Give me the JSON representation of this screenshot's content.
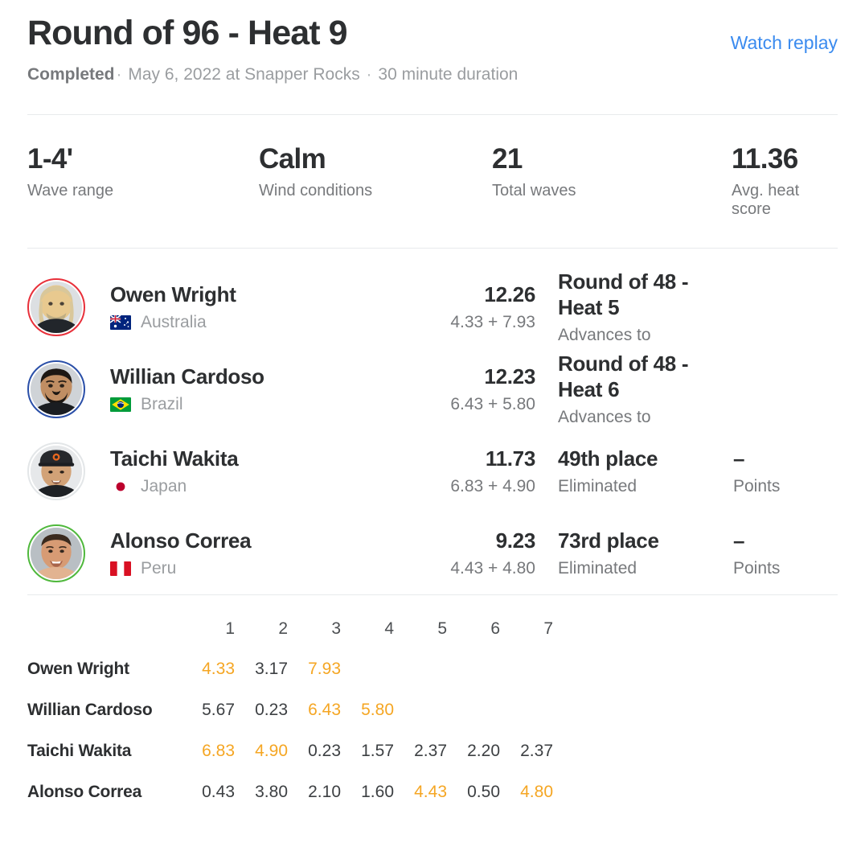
{
  "header": {
    "title": "Round of 96 - Heat 9",
    "watch_replay_label": "Watch replay",
    "status": "Completed",
    "meta": "May 6, 2022 at Snapper Rocks",
    "duration": "30 minute duration",
    "separator": "·"
  },
  "stats": [
    {
      "value": "1-4'",
      "label": "Wave range",
      "name": "wave-range"
    },
    {
      "value": "Calm",
      "label": "Wind conditions",
      "name": "wind-conditions"
    },
    {
      "value": "21",
      "label": "Total waves",
      "name": "total-waves"
    },
    {
      "value": "11.36",
      "label": "Avg. heat score",
      "name": "avg-heat-score"
    }
  ],
  "athletes": [
    {
      "name": "Owen Wright",
      "country": "Australia",
      "flag": "australia-flag",
      "jersey_color": "#e8303a",
      "total": "12.26",
      "breakdown": "4.33 + 7.93",
      "result_title": "Round of 48 - Heat 5",
      "result_sub": "Advances to",
      "points_value": "",
      "points_label": "",
      "has_points": false
    },
    {
      "name": "Willian Cardoso",
      "country": "Brazil",
      "flag": "brazil-flag",
      "jersey_color": "#2a4fa8",
      "total": "12.23",
      "breakdown": "6.43 + 5.80",
      "result_title": "Round of 48 - Heat 6",
      "result_sub": "Advances to",
      "points_value": "",
      "points_label": "",
      "has_points": false
    },
    {
      "name": "Taichi Wakita",
      "country": "Japan",
      "flag": "japan-flag",
      "jersey_color": "#e3e6e8",
      "total": "11.73",
      "breakdown": "6.83 + 4.90",
      "result_title": "49th place",
      "result_sub": "Eliminated",
      "points_value": "–",
      "points_label": "Points",
      "has_points": true
    },
    {
      "name": "Alonso Correa",
      "country": "Peru",
      "flag": "peru-flag",
      "jersey_color": "#4fb83c",
      "total": "9.23",
      "breakdown": "4.43 + 4.80",
      "result_title": "73rd place",
      "result_sub": "Eliminated",
      "points_value": "–",
      "points_label": "Points",
      "has_points": true
    }
  ],
  "wave_table": {
    "columns": [
      "1",
      "2",
      "3",
      "4",
      "5",
      "6",
      "7"
    ],
    "counted_color": "#f5a623",
    "rows": [
      {
        "name": "Owen Wright",
        "scores": [
          "4.33",
          "3.17",
          "7.93",
          "",
          "",
          "",
          ""
        ],
        "counted": [
          true,
          false,
          true,
          false,
          false,
          false,
          false
        ]
      },
      {
        "name": "Willian Cardoso",
        "scores": [
          "5.67",
          "0.23",
          "6.43",
          "5.80",
          "",
          "",
          ""
        ],
        "counted": [
          false,
          false,
          true,
          true,
          false,
          false,
          false
        ]
      },
      {
        "name": "Taichi Wakita",
        "scores": [
          "6.83",
          "4.90",
          "0.23",
          "1.57",
          "2.37",
          "2.20",
          "2.37"
        ],
        "counted": [
          true,
          true,
          false,
          false,
          false,
          false,
          false
        ]
      },
      {
        "name": "Alonso Correa",
        "scores": [
          "0.43",
          "3.80",
          "2.10",
          "1.60",
          "4.43",
          "0.50",
          "4.80"
        ],
        "counted": [
          false,
          false,
          false,
          false,
          true,
          false,
          true
        ]
      }
    ]
  },
  "colors": {
    "link": "#3b8bef",
    "accent": "#f5a623",
    "text": "#2d2f31",
    "muted": "#77797c",
    "light": "#9a9da0",
    "divider": "#e8eaec"
  }
}
